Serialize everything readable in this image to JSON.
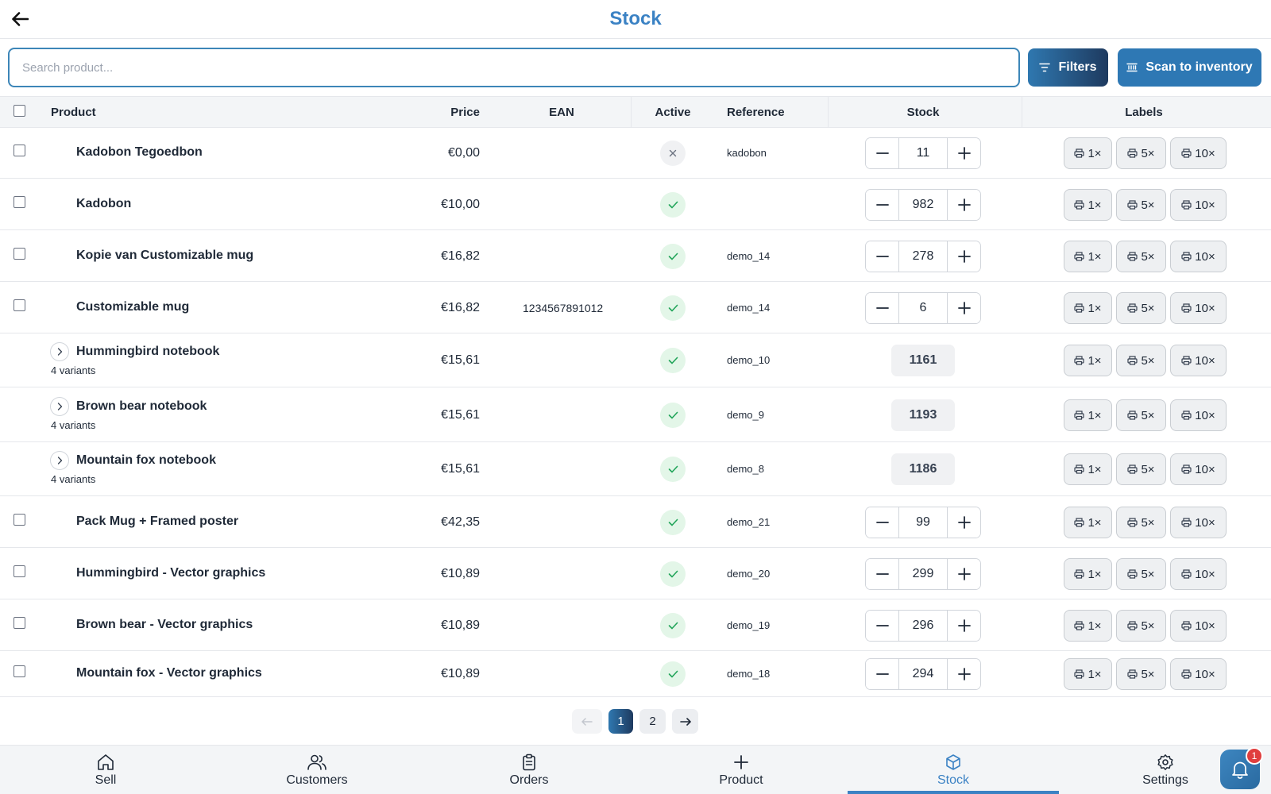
{
  "header": {
    "title": "Stock"
  },
  "search": {
    "placeholder": "Search product...",
    "value": ""
  },
  "toolbar": {
    "filters_label": "Filters",
    "scan_label": "Scan to inventory"
  },
  "table": {
    "columns": {
      "product": "Product",
      "price": "Price",
      "ean": "EAN",
      "active": "Active",
      "reference": "Reference",
      "stock": "Stock",
      "labels": "Labels"
    },
    "label_buttons": [
      "1×",
      "5×",
      "10×"
    ],
    "rows": [
      {
        "name": "Kadobon Tegoedbon",
        "price": "€0,00",
        "ean": "",
        "active": false,
        "reference": "kadobon",
        "stock": "11",
        "variants": ""
      },
      {
        "name": "Kadobon",
        "price": "€10,00",
        "ean": "",
        "active": true,
        "reference": "",
        "stock": "982",
        "variants": ""
      },
      {
        "name": "Kopie van Customizable mug",
        "price": "€16,82",
        "ean": "",
        "active": true,
        "reference": "demo_14",
        "stock": "278",
        "variants": ""
      },
      {
        "name": "Customizable mug",
        "price": "€16,82",
        "ean": "1234567891012",
        "active": true,
        "reference": "demo_14",
        "stock": "6",
        "variants": ""
      },
      {
        "name": "Hummingbird notebook",
        "price": "€15,61",
        "ean": "",
        "active": true,
        "reference": "demo_10",
        "stock": "1161",
        "variants": "4 variants"
      },
      {
        "name": "Brown bear notebook",
        "price": "€15,61",
        "ean": "",
        "active": true,
        "reference": "demo_9",
        "stock": "1193",
        "variants": "4 variants"
      },
      {
        "name": "Mountain fox notebook",
        "price": "€15,61",
        "ean": "",
        "active": true,
        "reference": "demo_8",
        "stock": "1186",
        "variants": "4 variants"
      },
      {
        "name": "Pack Mug + Framed poster",
        "price": "€42,35",
        "ean": "",
        "active": true,
        "reference": "demo_21",
        "stock": "99",
        "variants": ""
      },
      {
        "name": "Hummingbird - Vector graphics",
        "price": "€10,89",
        "ean": "",
        "active": true,
        "reference": "demo_20",
        "stock": "299",
        "variants": ""
      },
      {
        "name": "Brown bear - Vector graphics",
        "price": "€10,89",
        "ean": "",
        "active": true,
        "reference": "demo_19",
        "stock": "296",
        "variants": ""
      },
      {
        "name": "Mountain fox - Vector graphics",
        "price": "€10,89",
        "ean": "",
        "active": true,
        "reference": "demo_18",
        "stock": "294",
        "variants": ""
      }
    ]
  },
  "pagination": {
    "pages": [
      "1",
      "2"
    ],
    "current": "1",
    "prev_icon": "arrow-left-icon",
    "next_icon": "arrow-right-icon"
  },
  "bottom_nav": {
    "items": [
      {
        "label": "Sell",
        "icon": "home-icon"
      },
      {
        "label": "Customers",
        "icon": "users-icon"
      },
      {
        "label": "Orders",
        "icon": "clipboard-icon"
      },
      {
        "label": "Product",
        "icon": "plus-icon"
      },
      {
        "label": "Stock",
        "icon": "box-icon"
      },
      {
        "label": "Settings",
        "icon": "gear-icon"
      }
    ],
    "active": "Stock"
  },
  "notifications": {
    "count": "1",
    "icon": "bell-icon"
  },
  "colors": {
    "accent": "#3b82c4",
    "dark_gradient_end": "#1e3a5f",
    "active_green": "#22a55a"
  }
}
